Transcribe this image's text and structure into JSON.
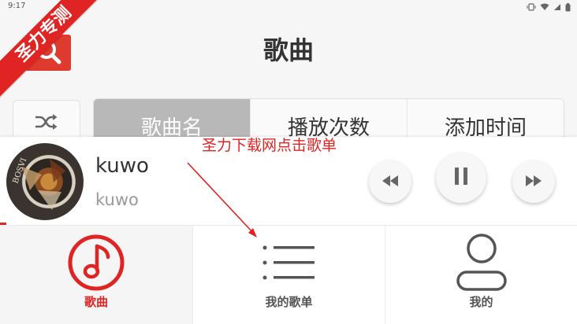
{
  "status_bar": {
    "time": "9:17"
  },
  "watermark": {
    "text": "圣力专测"
  },
  "header": {
    "title": "歌曲",
    "search_icon": "search-icon"
  },
  "sort_bar": {
    "shuffle_icon": "shuffle-icon",
    "tabs": [
      {
        "label": "歌曲名",
        "active": true
      },
      {
        "label": "播放次数",
        "active": false
      },
      {
        "label": "添加时间",
        "active": false
      }
    ]
  },
  "player": {
    "title": "kuwo",
    "artist": "kuwo",
    "controls": [
      "rewind-icon",
      "pause-icon",
      "fast-forward-icon"
    ]
  },
  "annotation": {
    "text": "圣力下载网点击歌单"
  },
  "bottom_nav": {
    "items": [
      {
        "label": "歌曲",
        "icon": "music-note-icon",
        "active": true
      },
      {
        "label": "我的歌单",
        "icon": "playlist-icon",
        "active": false
      },
      {
        "label": "我的",
        "icon": "person-icon",
        "active": false
      }
    ]
  },
  "colors": {
    "accent": "#e02323",
    "search_button": "#df3a2e",
    "active_tab": "#b8b8b8",
    "background": "#f6f6f6"
  }
}
